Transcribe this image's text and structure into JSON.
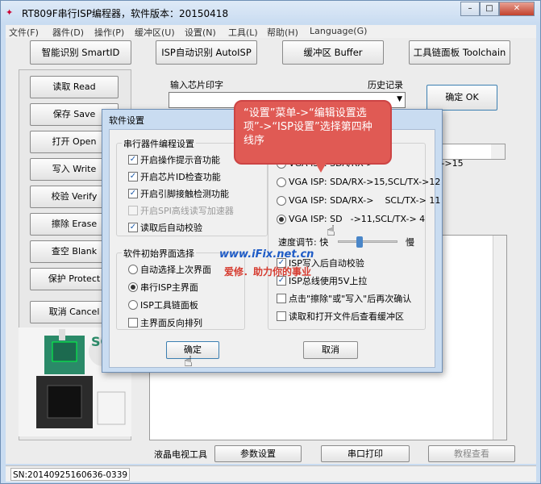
{
  "app": {
    "title": "RT809F串行ISP编程器，软件版本：20150418",
    "window_controls": {
      "minimize": "–",
      "maximize": "□",
      "close": "✕"
    }
  },
  "menu": [
    "文件(F)",
    "器件(D)",
    "操作(P)",
    "缓冲区(U)",
    "设置(N)",
    "工具(L)",
    "帮助(H)",
    "Language(G)"
  ],
  "toolbar": {
    "smart_id": "智能识别 SmartID",
    "isp_auto": "ISP自动识别 AutoISP",
    "buffer": "缓冲区 Buffer",
    "toolchain": "工具链面板 Toolchain"
  },
  "left_buttons": [
    "读取 Read",
    "保存 Save",
    "打开 Open",
    "写入 Write",
    "校验 Verify",
    "擦除 Erase",
    "查空 Blank",
    "保护 Protect",
    "取消 Cancel"
  ],
  "chip_image_label": "SO",
  "chip_input": {
    "label": "输入芯片印字",
    "history_label": "历史记录",
    "confirm": "确定 OK"
  },
  "bottom": {
    "label": "液晶电视工具",
    "params": "参数设置",
    "serial": "串口打印",
    "tutorial": "教程查看"
  },
  "status": {
    "sn": "SN:20140925160636-0339"
  },
  "dialog": {
    "title": "软件设置",
    "serial_group": {
      "title": "串行器件编程设置",
      "options": [
        {
          "label": "开启操作提示音功能",
          "checked": true,
          "disabled": false
        },
        {
          "label": "开启芯片ID检查功能",
          "checked": true,
          "disabled": false
        },
        {
          "label": "开启引脚接触检测功能",
          "checked": true,
          "disabled": false
        },
        {
          "label": "开启SPI高线读写加速器",
          "checked": false,
          "disabled": true
        },
        {
          "label": "读取后自动校验",
          "checked": true,
          "disabled": false
        }
      ]
    },
    "init_group": {
      "title": "软件初始界面选择",
      "options": [
        {
          "label": "自动选择上次界面",
          "selected": false
        },
        {
          "label": "串行ISP主界面",
          "selected": true
        },
        {
          "label": "ISP工具链面板",
          "selected": false
        }
      ],
      "reverse": {
        "label": "主界面反向排列",
        "checked": false
      }
    },
    "isp_lines": [
      {
        "label": "VGA ISP: SDA/RX->",
        "suffix": "->15",
        "selected": false
      },
      {
        "label": "VGA ISP: SDA/RX->15,SCL/TX->12",
        "selected": false
      },
      {
        "label": "VGA ISP: SDA/RX->",
        "suffix": "SCL/TX-> 11",
        "selected": false
      },
      {
        "label": "VGA ISP: SD",
        "suffix": "->11,SCL/TX-> 4",
        "selected": true
      }
    ],
    "speed": {
      "label": "速度调节: 快",
      "slow": "慢",
      "level": 0.35
    },
    "right_options": [
      {
        "label": "ISP写入后自动校验",
        "checked": true
      },
      {
        "label": "ISP总线使用5V上拉",
        "checked": true
      },
      {
        "label": "点击\"擦除\"或\"写入\"后再次确认",
        "checked": false
      },
      {
        "label": "读取和打开文件后查看缓冲区",
        "checked": false
      }
    ],
    "ok": "确定",
    "cancel": "取消"
  },
  "callout": "“设置”菜单->“编辑设置选项”->“ISP设置”选择第四种线序",
  "watermark": {
    "url": "www.iFix.net.cn",
    "slogan": "爱修．助力你的事业"
  },
  "colors": {
    "callout": "#e05a54",
    "window_frame": "#c9dcf1",
    "confirm_border": "#3c7fb1"
  }
}
